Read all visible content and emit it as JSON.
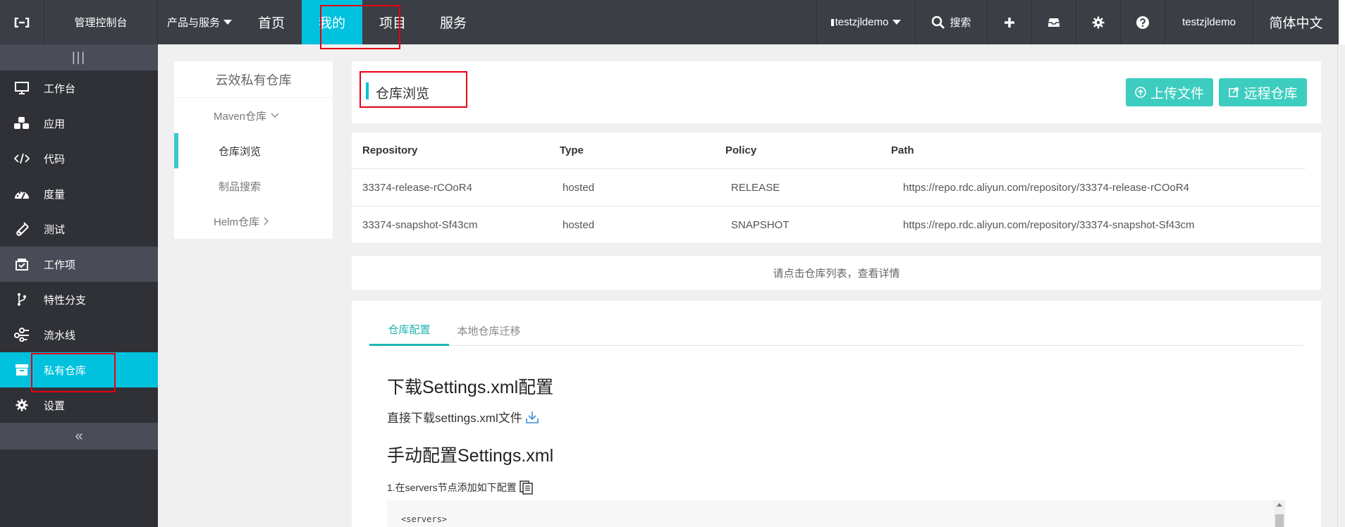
{
  "topbar": {
    "console": "管理控制台",
    "products": "产品与服务",
    "nav": [
      {
        "label": "首页",
        "active": false
      },
      {
        "label": "我的",
        "active": true
      },
      {
        "label": "项目",
        "active": false
      },
      {
        "label": "服务",
        "active": false
      }
    ],
    "account": "testzjldemo",
    "search": "搜索",
    "user": "testzjldemo",
    "language": "简体中文"
  },
  "sidebar": {
    "items": [
      {
        "label": "工作台",
        "icon": "monitor-icon"
      },
      {
        "label": "应用",
        "icon": "cubes-icon"
      },
      {
        "label": "代码",
        "icon": "code-icon"
      },
      {
        "label": "度量",
        "icon": "dashboard-icon"
      },
      {
        "label": "测试",
        "icon": "test-tube-icon"
      },
      {
        "label": "工作项",
        "icon": "inbox-check-icon"
      },
      {
        "label": "特性分支",
        "icon": "branch-icon"
      },
      {
        "label": "流水线",
        "icon": "pipeline-icon"
      },
      {
        "label": "私有仓库",
        "icon": "box-icon"
      },
      {
        "label": "设置",
        "icon": "gear-icon"
      }
    ]
  },
  "submenu": {
    "title": "云效私有仓库",
    "maven": "Maven仓库",
    "browse": "仓库浏览",
    "search": "制品搜索",
    "helm": "Helm仓库"
  },
  "main": {
    "title": "仓库浏览",
    "upload_label": "上传文件",
    "remote_label": "远程仓库"
  },
  "table": {
    "headers": [
      "Repository",
      "Type",
      "Policy",
      "Path"
    ],
    "rows": [
      [
        "33374-release-rCOoR4",
        "hosted",
        "RELEASE",
        "https://repo.rdc.aliyun.com/repository/33374-release-rCOoR4"
      ],
      [
        "33374-snapshot-Sf43cm",
        "hosted",
        "SNAPSHOT",
        "https://repo.rdc.aliyun.com/repository/33374-snapshot-Sf43cm"
      ]
    ]
  },
  "hint": "请点击仓库列表，查看详情",
  "config": {
    "tabs": [
      "仓库配置",
      "本地仓库迁移"
    ],
    "download_heading": "下载Settings.xml配置",
    "direct_download": "直接下载settings.xml文件",
    "manual_heading": "手动配置Settings.xml",
    "step1": "1.在servers节点添加如下配置",
    "code_line": "<servers>"
  },
  "colors": {
    "topbar": "#3b3e44",
    "sidebar": "#2f3137",
    "accent": "#00c1de",
    "button": "#3dcdc0",
    "annotation": "#e60012"
  }
}
